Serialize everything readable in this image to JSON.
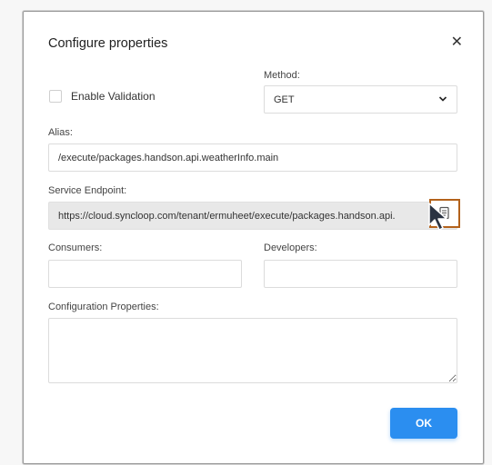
{
  "dialog": {
    "title": "Configure properties",
    "close_icon": "✕"
  },
  "validation": {
    "label": "Enable Validation",
    "checked": false
  },
  "method": {
    "label": "Method:",
    "value": "GET"
  },
  "alias": {
    "label": "Alias:",
    "value": "/execute/packages.handson.api.weatherInfo.main"
  },
  "endpoint": {
    "label": "Service Endpoint:",
    "value": "https://cloud.syncloop.com/tenant/ermuheet/execute/packages.handson.api.",
    "copy_icon": "copy-icon"
  },
  "consumers": {
    "label": "Consumers:",
    "value": ""
  },
  "developers": {
    "label": "Developers:",
    "value": ""
  },
  "config": {
    "label": "Configuration Properties:",
    "value": ""
  },
  "actions": {
    "ok_label": "OK"
  },
  "colors": {
    "primary": "#2b8ef0",
    "highlight": "#b3621b",
    "readonly_bg": "#e8e8e8"
  }
}
